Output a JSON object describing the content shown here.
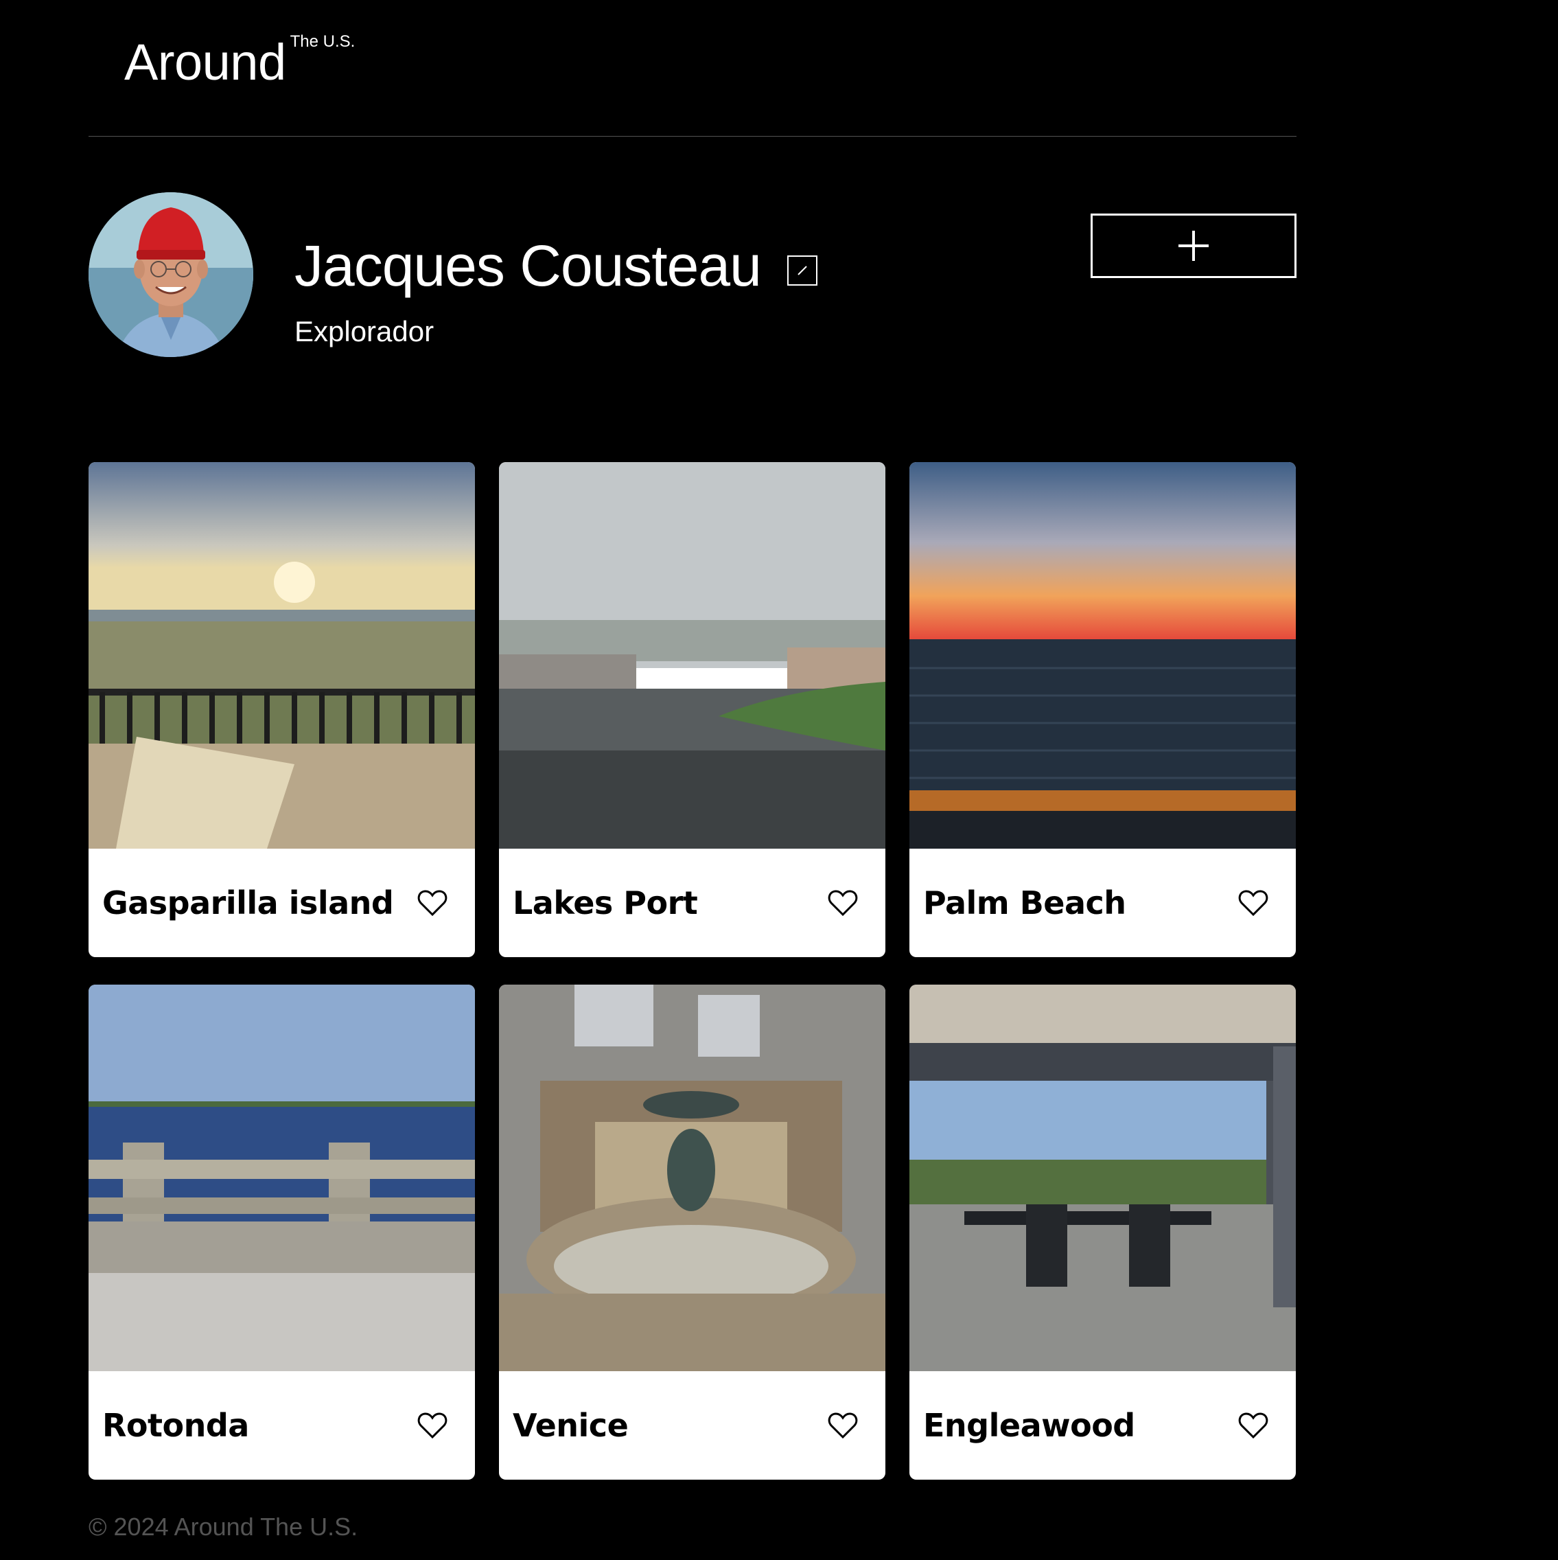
{
  "header": {
    "logo_main": "Around",
    "logo_sup": "The U.S."
  },
  "profile": {
    "name": "Jacques Cousteau",
    "about": "Explorador",
    "edit_icon": "pencil-icon",
    "add_icon": "plus-icon"
  },
  "cards": [
    {
      "title": "Gasparilla island",
      "icon": "heart-icon"
    },
    {
      "title": "Lakes Port",
      "icon": "heart-icon"
    },
    {
      "title": "Palm Beach",
      "icon": "heart-icon"
    },
    {
      "title": "Rotonda",
      "icon": "heart-icon"
    },
    {
      "title": "Venice",
      "icon": "heart-icon"
    },
    {
      "title": "Engleawood",
      "icon": "heart-icon"
    }
  ],
  "footer": {
    "copyright": "© 2024 Around The U.S."
  },
  "colors": {
    "background": "#000000",
    "card": "#ffffff",
    "text_primary": "#ffffff",
    "text_muted": "#545454"
  }
}
